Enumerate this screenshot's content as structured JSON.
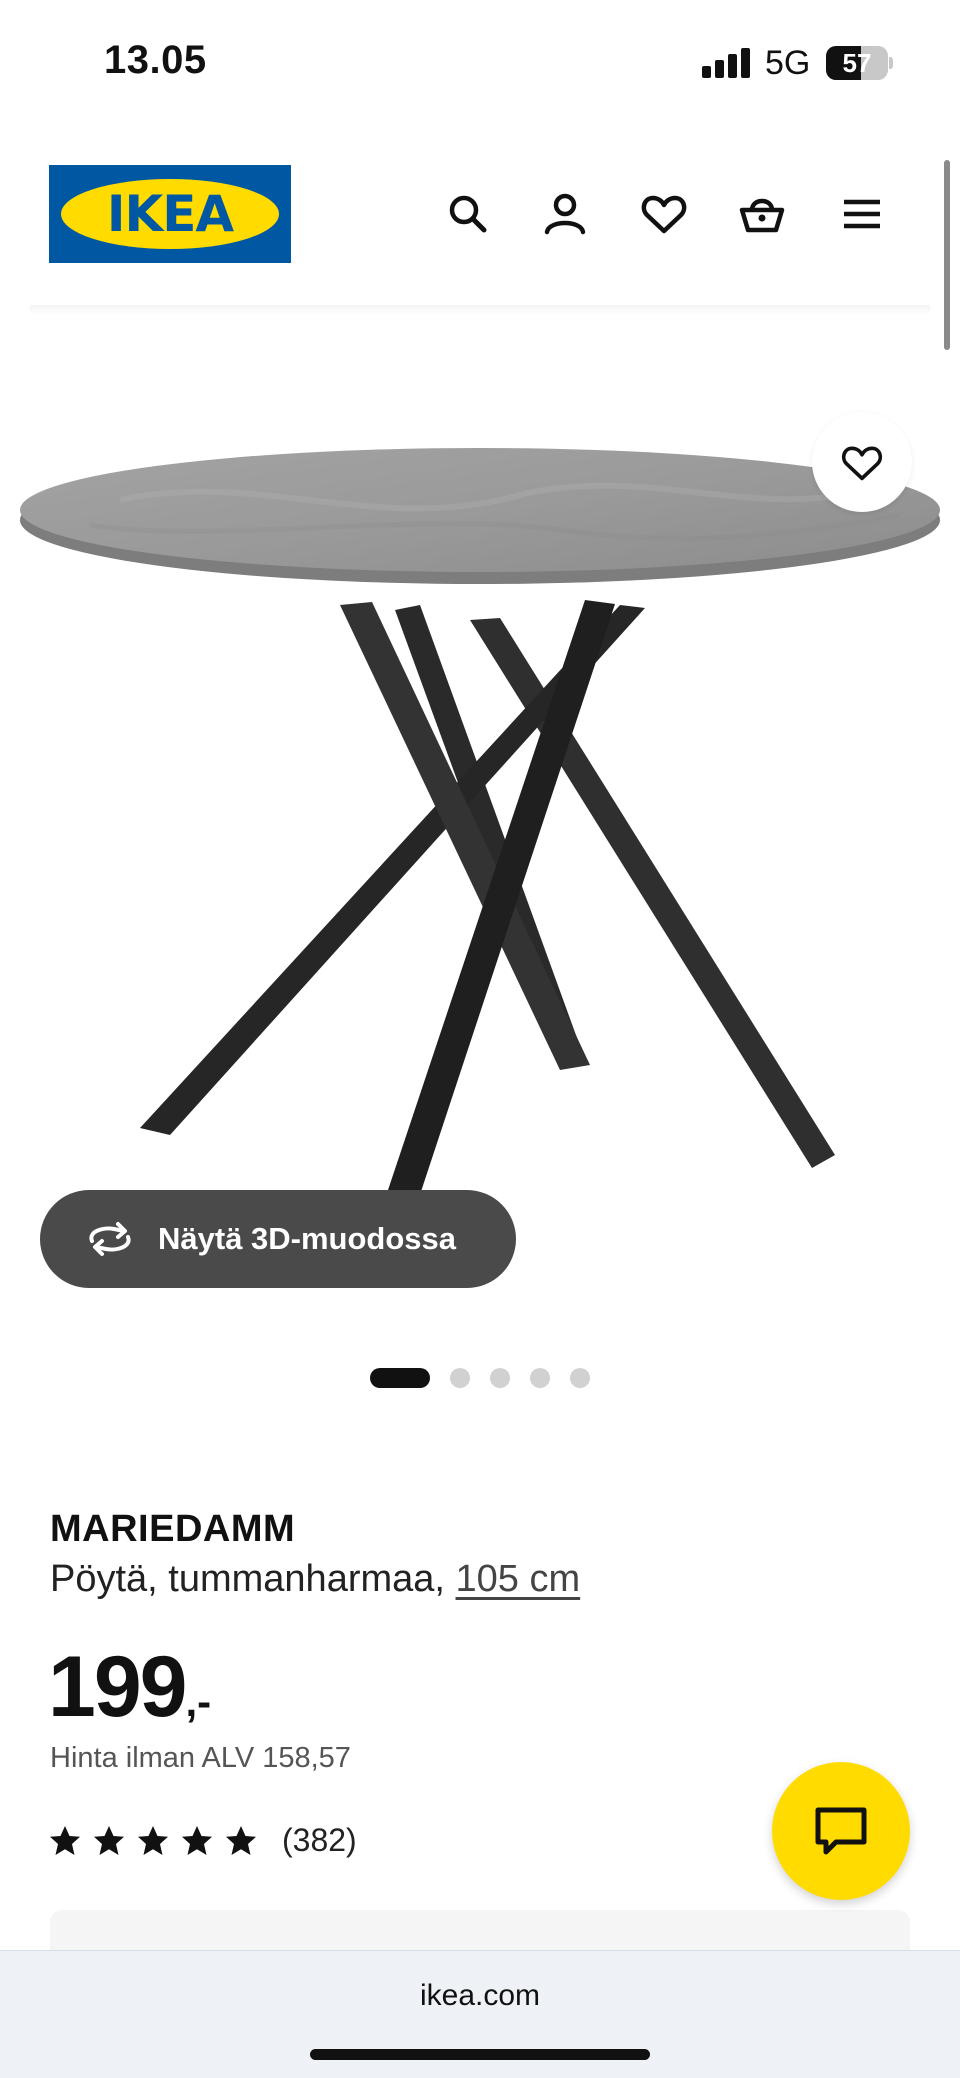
{
  "status_bar": {
    "time": "13.05",
    "network": "5G",
    "battery": "57",
    "battery_level": 0.57
  },
  "header": {
    "logo_text": "IKEA",
    "icons": [
      "search-icon",
      "account-icon",
      "heart-icon",
      "basket-icon",
      "menu-icon"
    ]
  },
  "gallery": {
    "view_3d_label": "Näytä 3D-muodossa",
    "image_count": 5,
    "active_image": 1
  },
  "product": {
    "name": "MARIEDAMM",
    "description": "Pöytä, tummanharmaa,",
    "size": "105 cm",
    "price": "199",
    "price_suffix": ",-",
    "price_vat": "Hinta ilman ALV 158,57",
    "rating": 5,
    "review_count": "(382)"
  },
  "browser": {
    "url": "ikea.com"
  },
  "colors": {
    "brand_blue": "#0058a3",
    "brand_yellow": "#ffdb00",
    "dark_button": "#4a4a4a"
  }
}
